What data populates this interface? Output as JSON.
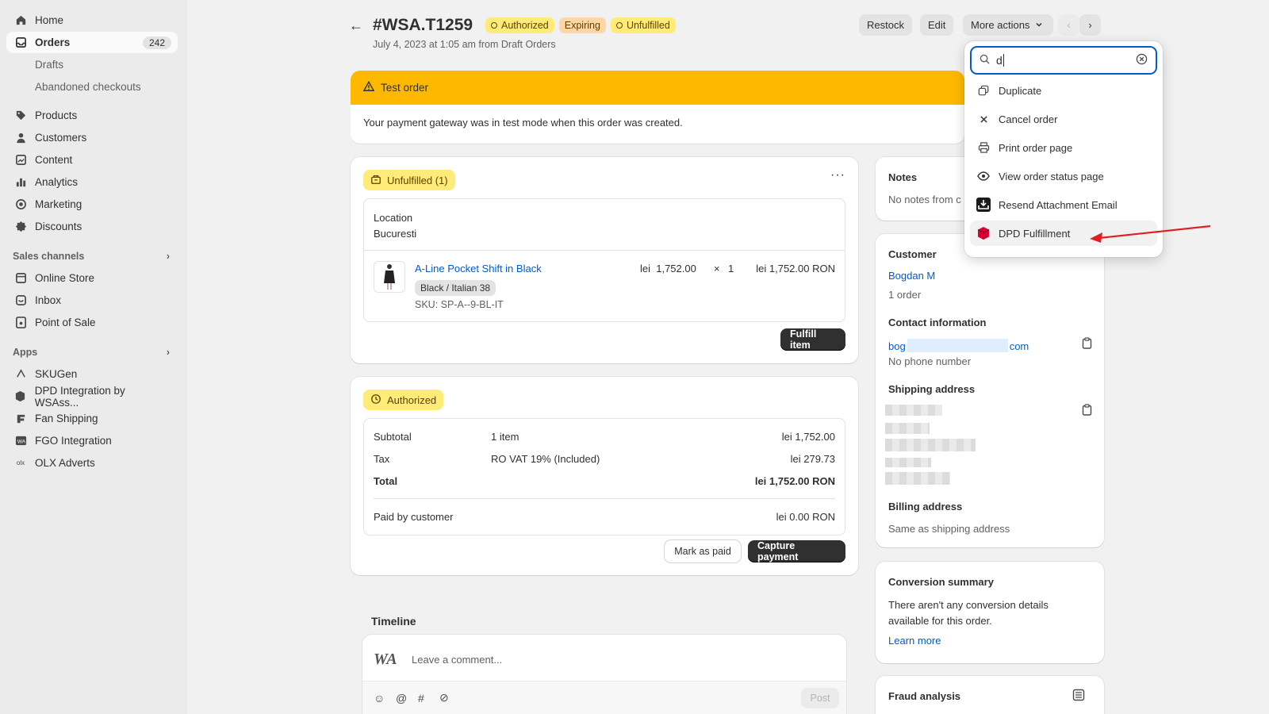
{
  "sidebar": {
    "nav": [
      {
        "label": "Home"
      },
      {
        "label": "Orders",
        "badge": "242"
      },
      {
        "label": "Products"
      },
      {
        "label": "Customers"
      },
      {
        "label": "Content"
      },
      {
        "label": "Analytics"
      },
      {
        "label": "Marketing"
      },
      {
        "label": "Discounts"
      }
    ],
    "orders_sub": [
      "Drafts",
      "Abandoned checkouts"
    ],
    "sales_channels_title": "Sales channels",
    "sales_channels": [
      "Online Store",
      "Inbox",
      "Point of Sale"
    ],
    "apps_title": "Apps",
    "apps": [
      "SKUGen",
      "DPD Integration by WSAss...",
      "Fan Shipping",
      "FGO Integration",
      "OLX Adverts"
    ]
  },
  "header": {
    "title": "#WSA.T1259",
    "badges": [
      "Authorized",
      "Expiring",
      "Unfulfilled"
    ],
    "subtitle": "July 4, 2023 at 1:05 am from Draft Orders",
    "restock": "Restock",
    "edit": "Edit",
    "more_actions": "More actions"
  },
  "banner": {
    "title": "Test order",
    "body": "Your payment gateway was in test mode when this order was created."
  },
  "fulfillment": {
    "status": "Unfulfilled (1)",
    "location_label": "Location",
    "location": "Bucuresti",
    "product_name": "A-Line Pocket Shift in Black",
    "variant": "Black / Italian 38",
    "sku": "SKU: SP-A--9-BL-IT",
    "unit_price": "lei  1,752.00",
    "times": "×",
    "qty": "1",
    "line_total": "lei 1,752.00 RON",
    "fulfill_button": "Fulfill item"
  },
  "payment": {
    "status": "Authorized",
    "rows": [
      {
        "label": "Subtotal",
        "desc": "1 item",
        "amount": "lei 1,752.00"
      },
      {
        "label": "Tax",
        "desc": "RO VAT 19% (Included)",
        "amount": "lei 279.73"
      },
      {
        "label": "Total",
        "desc": "",
        "amount": "lei 1,752.00 RON"
      }
    ],
    "paid_label": "Paid by customer",
    "paid_amount": "lei 0.00 RON",
    "mark_paid": "Mark as paid",
    "capture": "Capture payment"
  },
  "timeline": {
    "title": "Timeline",
    "placeholder": "Leave a comment...",
    "post": "Post"
  },
  "notes": {
    "title": "Notes",
    "text": "No notes from c"
  },
  "customer": {
    "title": "Customer",
    "name": "Bogdan M",
    "orders": "1 order",
    "contact_title": "Contact information",
    "email_start": "bog",
    "email_end": "com",
    "phone": "No phone number",
    "shipping_title": "Shipping address",
    "billing_title": "Billing address",
    "billing": "Same as shipping address"
  },
  "conversion": {
    "title": "Conversion summary",
    "text": "There aren't any conversion details available for this order.",
    "link": "Learn more"
  },
  "fraud": {
    "title": "Fraud analysis"
  },
  "dropdown": {
    "search_value": "d",
    "items": [
      {
        "label": "Duplicate",
        "icon": "duplicate-icon"
      },
      {
        "label": "Cancel order",
        "icon": "close-icon"
      },
      {
        "label": "Print order page",
        "icon": "printer-icon"
      },
      {
        "label": "View order status page",
        "icon": "eye-icon"
      },
      {
        "label": "Resend Attachment Email",
        "icon": "attachment-app-icon"
      },
      {
        "label": "DPD Fulfillment",
        "icon": "dpd-icon"
      }
    ]
  },
  "colors": {
    "accent": "#005bd3",
    "banner": "#ffb800",
    "badge_yellow": "#ffeb78",
    "annotation_arrow": "#e02020"
  }
}
